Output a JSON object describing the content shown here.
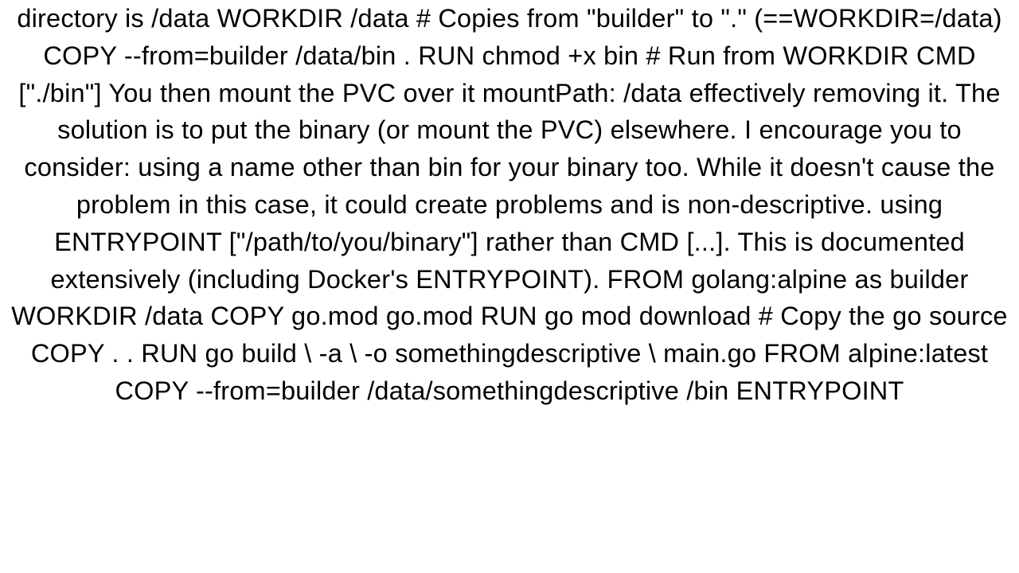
{
  "document": {
    "body_text": "directory is /data WORKDIR /data  # Copies from \"builder\" to \".\" (==WORKDIR=/data) COPY --from=builder /data/bin . RUN chmod +x bin  # Run from WORKDIR CMD [\"./bin\"]  You then mount the PVC over it mountPath: /data effectively removing it. The solution is to put the binary (or mount the PVC) elsewhere. I encourage you to consider:  using a name other than bin for your binary too. While it doesn't cause the problem in this case, it could create problems and is non-descriptive. using ENTRYPOINT [\"/path/to/you/binary\"] rather than CMD [...]. This is documented extensively (including Docker's ENTRYPOINT).  FROM golang:alpine as builder WORKDIR /data  COPY go.mod go.mod RUN go mod download  # Copy the go source COPY . .  RUN go build \\     -a \\     -o somethingdescriptive \\     main.go  FROM alpine:latest  COPY --from=builder /data/somethingdescriptive /bin  ENTRYPOINT"
  }
}
